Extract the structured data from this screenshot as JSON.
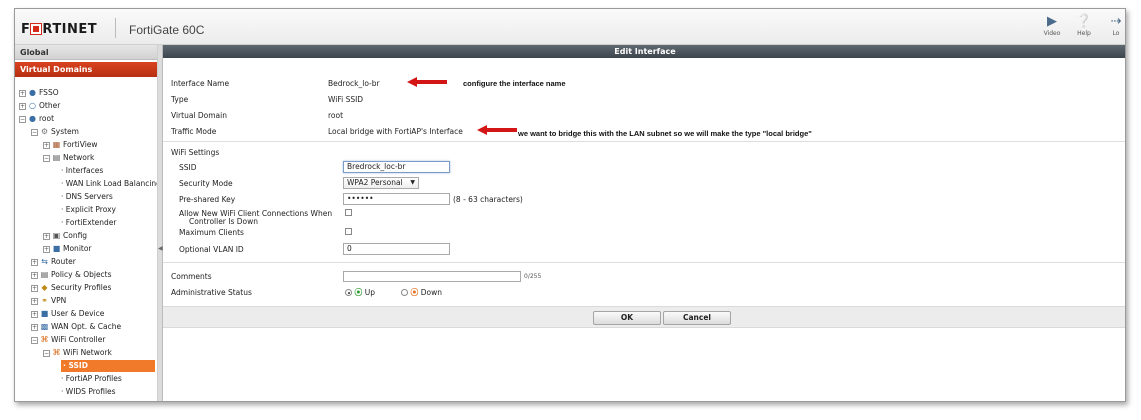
{
  "header": {
    "brand": "F■RTINET",
    "model": "FortiGate 60C",
    "icons": [
      {
        "name": "video-icon",
        "label": "Video"
      },
      {
        "name": "help-icon",
        "label": "Help"
      },
      {
        "name": "logout-icon",
        "label": "Lo"
      }
    ]
  },
  "sidebar": {
    "global": "Global",
    "virtual_domains": "Virtual Domains",
    "items": [
      {
        "label": "FSSO",
        "icon": "users-icon"
      },
      {
        "label": "Other",
        "icon": "circle-icon"
      },
      {
        "label": "root",
        "icon": "users-icon"
      },
      {
        "label": "System",
        "icon": "gear-icon"
      },
      {
        "label": "FortiView",
        "icon": "chart-icon"
      },
      {
        "label": "Network",
        "icon": "network-icon"
      },
      {
        "label": "Interfaces"
      },
      {
        "label": "WAN Link Load Balancing"
      },
      {
        "label": "DNS Servers"
      },
      {
        "label": "Explicit Proxy"
      },
      {
        "label": "FortiExtender"
      },
      {
        "label": "Config",
        "icon": "config-icon"
      },
      {
        "label": "Monitor",
        "icon": "monitor-icon"
      },
      {
        "label": "Router",
        "icon": "router-icon"
      },
      {
        "label": "Policy & Objects",
        "icon": "policy-icon"
      },
      {
        "label": "Security Profiles",
        "icon": "security-icon"
      },
      {
        "label": "VPN",
        "icon": "key-icon"
      },
      {
        "label": "User & Device",
        "icon": "user-icon"
      },
      {
        "label": "WAN Opt. & Cache",
        "icon": "wan-icon"
      },
      {
        "label": "WiFi Controller",
        "icon": "wifi-icon"
      },
      {
        "label": "WiFi Network",
        "icon": "wifi-icon"
      },
      {
        "label": "SSID"
      },
      {
        "label": "FortiAP Profiles"
      },
      {
        "label": "WIDS Profiles"
      }
    ]
  },
  "edit": {
    "title": "Edit Interface",
    "interface_name_label": "Interface Name",
    "interface_name": "Bedrock_lo-br",
    "note_name": "configure the interface name",
    "type_label": "Type",
    "type": "WiFi SSID",
    "vdom_label": "Virtual Domain",
    "vdom": "root",
    "traffic_mode_label": "Traffic Mode",
    "traffic_mode": "Local bridge with FortiAP's Interface",
    "note_traffic": "we want to bridge this with the LAN subnet so we will make the type \"local bridge\"",
    "wifi_settings": "WiFi Settings",
    "ssid_label": "SSID",
    "ssid": "Bredrock_loc-br",
    "security_mode_label": "Security Mode",
    "security_mode": "WPA2 Personal",
    "psk_label": "Pre-shared Key",
    "psk": "••••••",
    "psk_hint": "(8 - 63 characters)",
    "allow_new_label": "Allow New WiFi Client Connections When",
    "allow_new_label2": "Controller Is Down",
    "max_clients_label": "Maximum Clients",
    "vlan_label": "Optional VLAN ID",
    "vlan": "0",
    "comments_label": "Comments",
    "comments_count": "0/255",
    "admin_status_label": "Administrative Status",
    "status_up": "Up",
    "status_down": "Down",
    "ok": "OK",
    "cancel": "Cancel"
  },
  "colors": {
    "accent": "#d32a1a",
    "selected": "#f07a2a",
    "header_bar": "#4a535b"
  }
}
